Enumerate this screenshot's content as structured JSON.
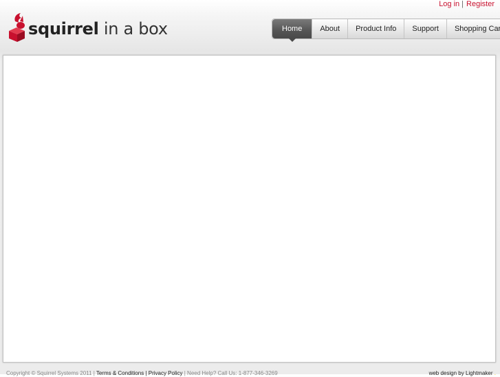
{
  "top_links": {
    "login": "Log in",
    "separator": "|",
    "register": "Register"
  },
  "logo": {
    "icon": "squirrel-box-icon",
    "word1": "squirrel",
    "word2": "in a box",
    "brand_color": "#c8102e"
  },
  "nav": {
    "items": [
      {
        "label": "Home",
        "active": true
      },
      {
        "label": "About"
      },
      {
        "label": "Product Info"
      },
      {
        "label": "Support"
      },
      {
        "label": "Shopping Cart"
      }
    ]
  },
  "footer": {
    "copyright": "Copyright © Squirrel Systems 2011 | ",
    "terms": "Terms & Conditions",
    "sep1": " | ",
    "privacy": "Privacy Policy",
    "help": " | Need Help? Call Us: 1-877-346-3269",
    "credit_prefix": "web design by ",
    "credit_name": "Lightmaker",
    "credit_badge": "."
  },
  "colors": {
    "accent": "#c8102e",
    "nav_active": "#555555",
    "credit": "#f2c200"
  }
}
